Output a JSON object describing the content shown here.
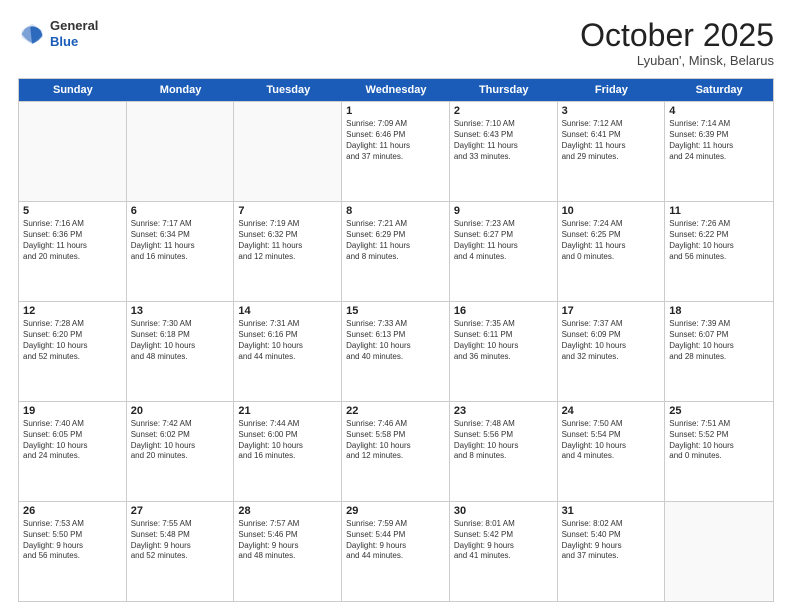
{
  "logo": {
    "general": "General",
    "blue": "Blue"
  },
  "header": {
    "month": "October 2025",
    "location": "Lyuban', Minsk, Belarus"
  },
  "weekdays": [
    "Sunday",
    "Monday",
    "Tuesday",
    "Wednesday",
    "Thursday",
    "Friday",
    "Saturday"
  ],
  "rows": [
    [
      {
        "day": "",
        "info": ""
      },
      {
        "day": "",
        "info": ""
      },
      {
        "day": "",
        "info": ""
      },
      {
        "day": "1",
        "info": "Sunrise: 7:09 AM\nSunset: 6:46 PM\nDaylight: 11 hours\nand 37 minutes."
      },
      {
        "day": "2",
        "info": "Sunrise: 7:10 AM\nSunset: 6:43 PM\nDaylight: 11 hours\nand 33 minutes."
      },
      {
        "day": "3",
        "info": "Sunrise: 7:12 AM\nSunset: 6:41 PM\nDaylight: 11 hours\nand 29 minutes."
      },
      {
        "day": "4",
        "info": "Sunrise: 7:14 AM\nSunset: 6:39 PM\nDaylight: 11 hours\nand 24 minutes."
      }
    ],
    [
      {
        "day": "5",
        "info": "Sunrise: 7:16 AM\nSunset: 6:36 PM\nDaylight: 11 hours\nand 20 minutes."
      },
      {
        "day": "6",
        "info": "Sunrise: 7:17 AM\nSunset: 6:34 PM\nDaylight: 11 hours\nand 16 minutes."
      },
      {
        "day": "7",
        "info": "Sunrise: 7:19 AM\nSunset: 6:32 PM\nDaylight: 11 hours\nand 12 minutes."
      },
      {
        "day": "8",
        "info": "Sunrise: 7:21 AM\nSunset: 6:29 PM\nDaylight: 11 hours\nand 8 minutes."
      },
      {
        "day": "9",
        "info": "Sunrise: 7:23 AM\nSunset: 6:27 PM\nDaylight: 11 hours\nand 4 minutes."
      },
      {
        "day": "10",
        "info": "Sunrise: 7:24 AM\nSunset: 6:25 PM\nDaylight: 11 hours\nand 0 minutes."
      },
      {
        "day": "11",
        "info": "Sunrise: 7:26 AM\nSunset: 6:22 PM\nDaylight: 10 hours\nand 56 minutes."
      }
    ],
    [
      {
        "day": "12",
        "info": "Sunrise: 7:28 AM\nSunset: 6:20 PM\nDaylight: 10 hours\nand 52 minutes."
      },
      {
        "day": "13",
        "info": "Sunrise: 7:30 AM\nSunset: 6:18 PM\nDaylight: 10 hours\nand 48 minutes."
      },
      {
        "day": "14",
        "info": "Sunrise: 7:31 AM\nSunset: 6:16 PM\nDaylight: 10 hours\nand 44 minutes."
      },
      {
        "day": "15",
        "info": "Sunrise: 7:33 AM\nSunset: 6:13 PM\nDaylight: 10 hours\nand 40 minutes."
      },
      {
        "day": "16",
        "info": "Sunrise: 7:35 AM\nSunset: 6:11 PM\nDaylight: 10 hours\nand 36 minutes."
      },
      {
        "day": "17",
        "info": "Sunrise: 7:37 AM\nSunset: 6:09 PM\nDaylight: 10 hours\nand 32 minutes."
      },
      {
        "day": "18",
        "info": "Sunrise: 7:39 AM\nSunset: 6:07 PM\nDaylight: 10 hours\nand 28 minutes."
      }
    ],
    [
      {
        "day": "19",
        "info": "Sunrise: 7:40 AM\nSunset: 6:05 PM\nDaylight: 10 hours\nand 24 minutes."
      },
      {
        "day": "20",
        "info": "Sunrise: 7:42 AM\nSunset: 6:02 PM\nDaylight: 10 hours\nand 20 minutes."
      },
      {
        "day": "21",
        "info": "Sunrise: 7:44 AM\nSunset: 6:00 PM\nDaylight: 10 hours\nand 16 minutes."
      },
      {
        "day": "22",
        "info": "Sunrise: 7:46 AM\nSunset: 5:58 PM\nDaylight: 10 hours\nand 12 minutes."
      },
      {
        "day": "23",
        "info": "Sunrise: 7:48 AM\nSunset: 5:56 PM\nDaylight: 10 hours\nand 8 minutes."
      },
      {
        "day": "24",
        "info": "Sunrise: 7:50 AM\nSunset: 5:54 PM\nDaylight: 10 hours\nand 4 minutes."
      },
      {
        "day": "25",
        "info": "Sunrise: 7:51 AM\nSunset: 5:52 PM\nDaylight: 10 hours\nand 0 minutes."
      }
    ],
    [
      {
        "day": "26",
        "info": "Sunrise: 7:53 AM\nSunset: 5:50 PM\nDaylight: 9 hours\nand 56 minutes."
      },
      {
        "day": "27",
        "info": "Sunrise: 7:55 AM\nSunset: 5:48 PM\nDaylight: 9 hours\nand 52 minutes."
      },
      {
        "day": "28",
        "info": "Sunrise: 7:57 AM\nSunset: 5:46 PM\nDaylight: 9 hours\nand 48 minutes."
      },
      {
        "day": "29",
        "info": "Sunrise: 7:59 AM\nSunset: 5:44 PM\nDaylight: 9 hours\nand 44 minutes."
      },
      {
        "day": "30",
        "info": "Sunrise: 8:01 AM\nSunset: 5:42 PM\nDaylight: 9 hours\nand 41 minutes."
      },
      {
        "day": "31",
        "info": "Sunrise: 8:02 AM\nSunset: 5:40 PM\nDaylight: 9 hours\nand 37 minutes."
      },
      {
        "day": "",
        "info": ""
      }
    ]
  ]
}
